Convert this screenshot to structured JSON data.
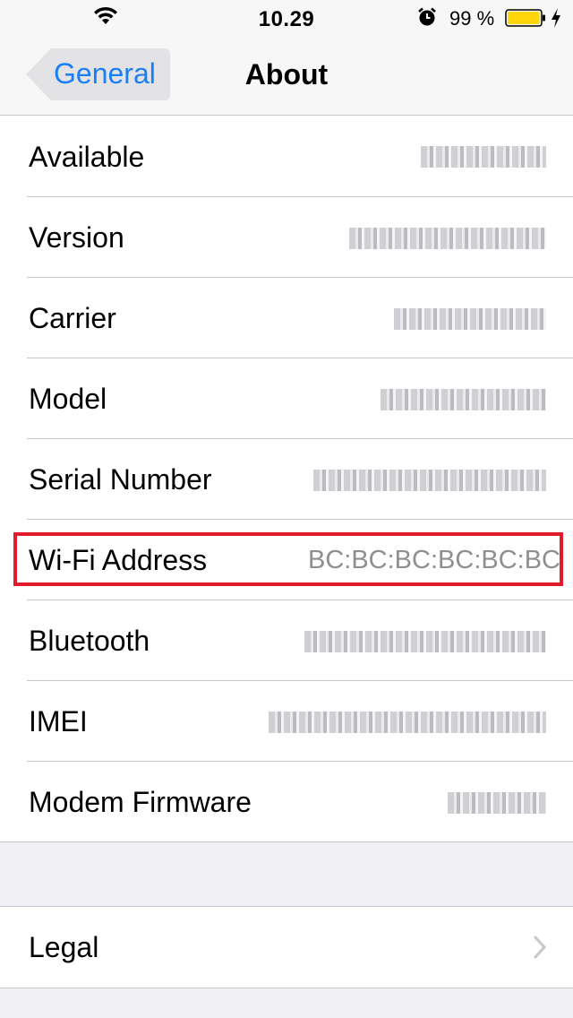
{
  "status_bar": {
    "time": "10.29",
    "battery_percent": "99 %",
    "battery_level": 0.99,
    "battery_color": "#ffd60a",
    "icons": [
      "wifi-icon",
      "alarm-icon",
      "battery-icon",
      "charging-bolt-icon"
    ]
  },
  "nav": {
    "back_label": "General",
    "title": "About",
    "accent": "#1a7ef5"
  },
  "rows": [
    {
      "label": "Available",
      "value": ""
    },
    {
      "label": "Version",
      "value": ""
    },
    {
      "label": "Carrier",
      "value": ""
    },
    {
      "label": "Model",
      "value": ""
    },
    {
      "label": "Serial Number",
      "value": ""
    },
    {
      "label": "Wi-Fi Address",
      "value": "BC:BC:BC:BC:BC:BC"
    },
    {
      "label": "Bluetooth",
      "value": ""
    },
    {
      "label": "IMEI",
      "value": ""
    },
    {
      "label": "Modem Firmware",
      "value": ""
    }
  ],
  "legal": {
    "label": "Legal",
    "icon": "chevron-right-icon"
  },
  "highlight_color": "#e21b2a"
}
